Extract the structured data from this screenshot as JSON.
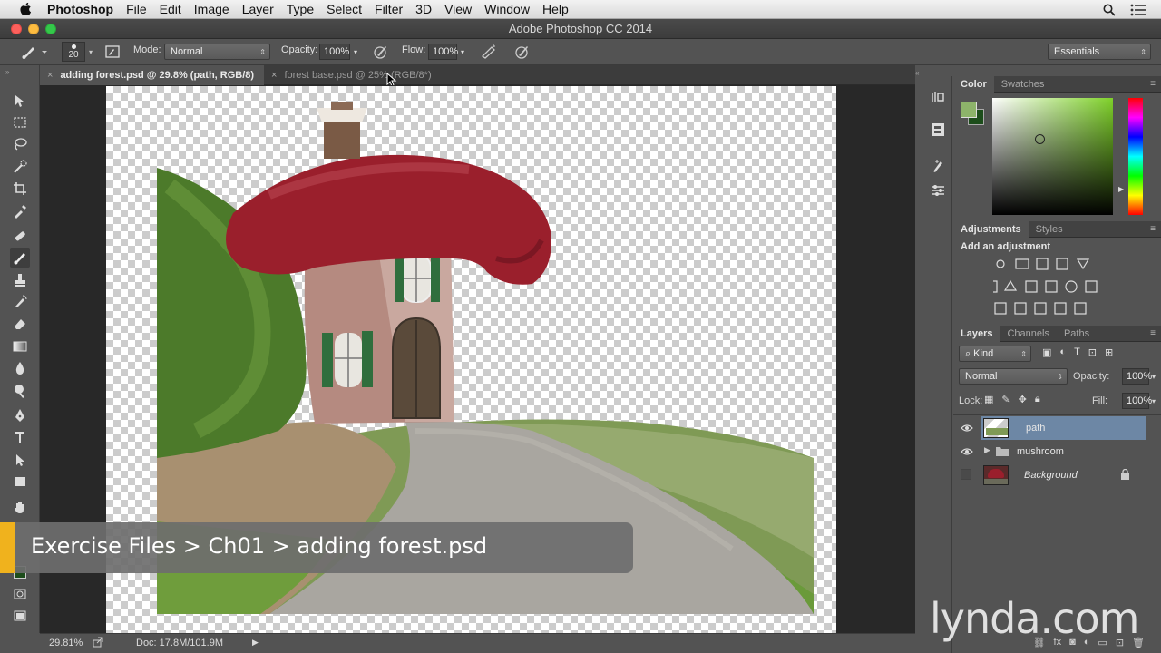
{
  "menubar": {
    "app_name": "Photoshop",
    "items": [
      "File",
      "Edit",
      "Image",
      "Layer",
      "Type",
      "Select",
      "Filter",
      "3D",
      "View",
      "Window",
      "Help"
    ]
  },
  "window": {
    "title": "Adobe Photoshop CC 2014"
  },
  "options": {
    "brush_size": "20",
    "mode_label": "Mode:",
    "mode_value": "Normal",
    "opacity_label": "Opacity:",
    "opacity_value": "100%",
    "flow_label": "Flow:",
    "flow_value": "100%",
    "workspace": "Essentials"
  },
  "tabs": [
    {
      "label": "adding forest.psd @ 29.8% (path, RGB/8)",
      "active": true
    },
    {
      "label": "forest base.psd @ 25% (RGB/8*)",
      "active": false
    }
  ],
  "caption": "Exercise Files > Ch01 > adding forest.psd",
  "status": {
    "zoom": "29.81%",
    "doc": "Doc: 17.8M/101.9M"
  },
  "color_panel": {
    "tabs": [
      "Color",
      "Swatches"
    ],
    "foreground": "#8db36a",
    "background": "#1d4d1b"
  },
  "adjustments_panel": {
    "tabs": [
      "Adjustments",
      "Styles"
    ],
    "heading": "Add an adjustment"
  },
  "layers_panel": {
    "tabs": [
      "Layers",
      "Channels",
      "Paths"
    ],
    "filter_value": "Kind",
    "blend_mode": "Normal",
    "opacity_label": "Opacity:",
    "opacity_value": "100%",
    "lock_label": "Lock:",
    "fill_label": "Fill:",
    "fill_value": "100%",
    "layers": [
      {
        "name": "path",
        "visible": true,
        "selected": true
      },
      {
        "name": "mushroom",
        "visible": true,
        "selected": false
      },
      {
        "name": "Background",
        "visible": false,
        "selected": false,
        "locked": true
      }
    ]
  },
  "watermark": "lynda.com"
}
